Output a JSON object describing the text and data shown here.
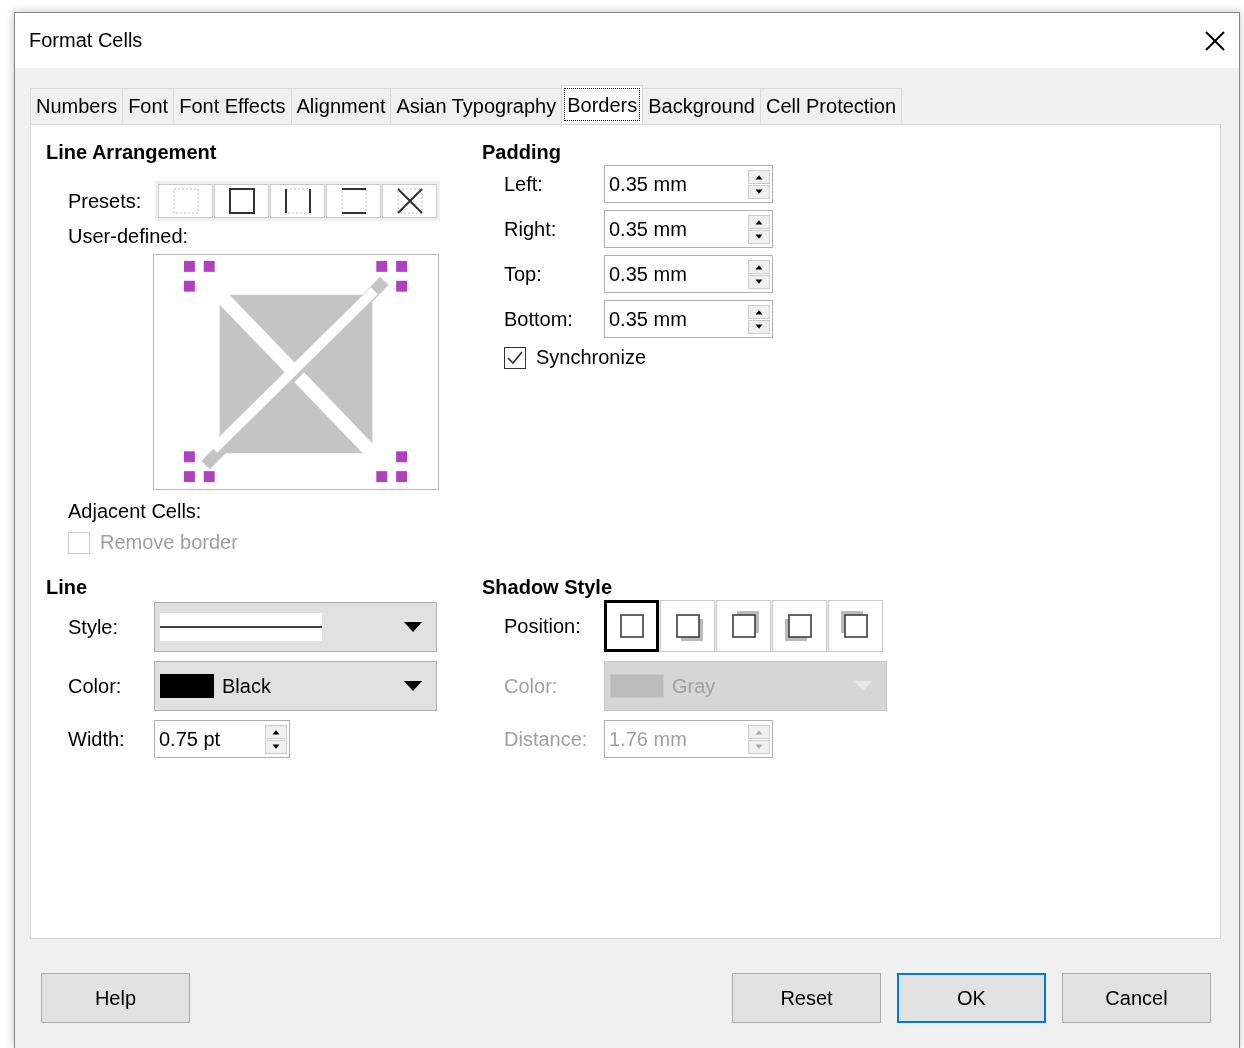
{
  "window": {
    "title": "Format Cells"
  },
  "tabs": [
    {
      "label": "Numbers",
      "selected": false
    },
    {
      "label": "Font",
      "selected": false
    },
    {
      "label": "Font Effects",
      "selected": false
    },
    {
      "label": "Alignment",
      "selected": false
    },
    {
      "label": "Asian Typography",
      "selected": false
    },
    {
      "label": "Borders",
      "selected": true
    },
    {
      "label": "Background",
      "selected": false
    },
    {
      "label": "Cell Protection",
      "selected": false
    }
  ],
  "line_arrangement": {
    "title": "Line Arrangement",
    "presets_label": "Presets:",
    "presets": [
      {
        "kind": "none"
      },
      {
        "kind": "outer"
      },
      {
        "kind": "left-right"
      },
      {
        "kind": "top-bottom"
      },
      {
        "kind": "diagonal"
      }
    ],
    "user_defined_label": "User-defined:"
  },
  "adjacent_cells": {
    "label": "Adjacent Cells:",
    "remove_border": {
      "label": "Remove border",
      "checked": false,
      "disabled": true
    }
  },
  "padding": {
    "title": "Padding",
    "fields": [
      {
        "label": "Left:",
        "value": "0.35 mm"
      },
      {
        "label": "Right:",
        "value": "0.35 mm"
      },
      {
        "label": "Top:",
        "value": "0.35 mm"
      },
      {
        "label": "Bottom:",
        "value": "0.35 mm"
      }
    ],
    "synchronize": {
      "label": "Synchronize",
      "checked": true
    }
  },
  "line": {
    "title": "Line",
    "style": {
      "label": "Style:"
    },
    "color": {
      "label": "Color:",
      "value": "Black",
      "color": "#000000"
    },
    "width": {
      "label": "Width:",
      "value": "0.75 pt"
    }
  },
  "shadow": {
    "title": "Shadow Style",
    "position_label": "Position:",
    "positions": [
      {
        "kind": "none",
        "selected": true
      },
      {
        "kind": "bottom-right",
        "selected": false
      },
      {
        "kind": "top-right",
        "selected": false
      },
      {
        "kind": "bottom-left",
        "selected": false
      },
      {
        "kind": "top-left",
        "selected": false
      }
    ],
    "color": {
      "label": "Color:",
      "value": "Gray",
      "color": "#bcbcbc",
      "disabled": true
    },
    "distance": {
      "label": "Distance:",
      "value": "1.76 mm",
      "disabled": true
    }
  },
  "buttons": [
    {
      "label": "Help",
      "default": false
    },
    {
      "label": "Reset",
      "default": false
    },
    {
      "label": "OK",
      "default": true
    },
    {
      "label": "Cancel",
      "default": false
    }
  ]
}
